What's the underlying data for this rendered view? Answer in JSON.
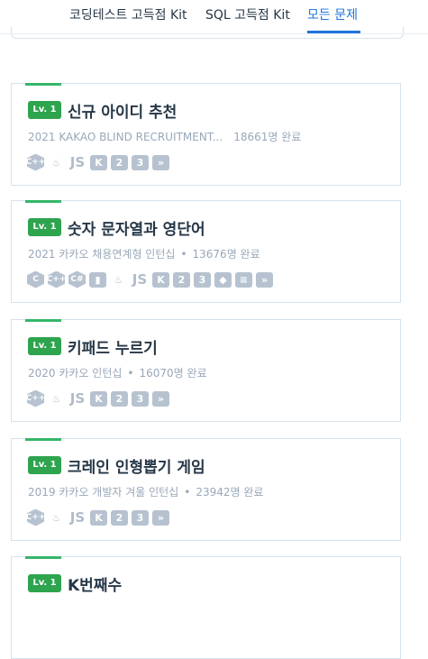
{
  "tabs": [
    {
      "label": "코딩테스트 고득점 Kit",
      "active": false
    },
    {
      "label": "SQL 고득점 Kit",
      "active": false
    },
    {
      "label": "모든 문제",
      "active": true
    }
  ],
  "colors": {
    "accent": "#1f74d9",
    "level_badge": "#2ea44f",
    "card_border": "#d7e2eb",
    "meta_text": "#98a8b9",
    "icon": "#b6c2cf"
  },
  "cards": [
    {
      "level": "Lv. 1",
      "title": "신규 아이디 추천",
      "source": "2021 KAKAO BLIND RECRUITMENT...",
      "separator": "",
      "completed": "18661명 완료",
      "languages": [
        {
          "icon": "cpp-icon",
          "glyph": "C++"
        },
        {
          "icon": "java-icon",
          "glyph": "♨"
        },
        {
          "icon": "javascript-icon",
          "glyph": "JS"
        },
        {
          "icon": "kotlin-icon",
          "glyph": "K"
        },
        {
          "icon": "python2-icon",
          "glyph": "2"
        },
        {
          "icon": "python3-icon",
          "glyph": "3"
        },
        {
          "icon": "swift-icon",
          "glyph": "»"
        }
      ]
    },
    {
      "level": "Lv. 1",
      "title": "숫자 문자열과 영단어",
      "source": "2021 카카오 채용연계형 인턴십",
      "separator": "•",
      "completed": "13676명 완료",
      "languages": [
        {
          "icon": "c-icon",
          "glyph": "C"
        },
        {
          "icon": "cpp-icon",
          "glyph": "C++"
        },
        {
          "icon": "csharp-icon",
          "glyph": "C#"
        },
        {
          "icon": "go-icon",
          "glyph": "▮"
        },
        {
          "icon": "java-icon",
          "glyph": "♨"
        },
        {
          "icon": "javascript-icon",
          "glyph": "JS"
        },
        {
          "icon": "kotlin-icon",
          "glyph": "K"
        },
        {
          "icon": "python2-icon",
          "glyph": "2"
        },
        {
          "icon": "python3-icon",
          "glyph": "3"
        },
        {
          "icon": "ruby-icon",
          "glyph": "◆"
        },
        {
          "icon": "scala-icon",
          "glyph": "≡"
        },
        {
          "icon": "swift-icon",
          "glyph": "»"
        }
      ]
    },
    {
      "level": "Lv. 1",
      "title": "키패드 누르기",
      "source": "2020 카카오 인턴십",
      "separator": "•",
      "completed": "16070명 완료",
      "languages": [
        {
          "icon": "cpp-icon",
          "glyph": "C++"
        },
        {
          "icon": "java-icon",
          "glyph": "♨"
        },
        {
          "icon": "javascript-icon",
          "glyph": "JS"
        },
        {
          "icon": "kotlin-icon",
          "glyph": "K"
        },
        {
          "icon": "python2-icon",
          "glyph": "2"
        },
        {
          "icon": "python3-icon",
          "glyph": "3"
        },
        {
          "icon": "swift-icon",
          "glyph": "»"
        }
      ]
    },
    {
      "level": "Lv. 1",
      "title": "크레인 인형뽑기 게임",
      "source": "2019 카카오 개발자 겨울 인턴십",
      "separator": "•",
      "completed": "23942명 완료",
      "languages": [
        {
          "icon": "cpp-icon",
          "glyph": "C++"
        },
        {
          "icon": "java-icon",
          "glyph": "♨"
        },
        {
          "icon": "javascript-icon",
          "glyph": "JS"
        },
        {
          "icon": "kotlin-icon",
          "glyph": "K"
        },
        {
          "icon": "python2-icon",
          "glyph": "2"
        },
        {
          "icon": "python3-icon",
          "glyph": "3"
        },
        {
          "icon": "swift-icon",
          "glyph": "»"
        }
      ]
    },
    {
      "level": "Lv. 1",
      "title": "K번째수",
      "source": "",
      "separator": "",
      "completed": "",
      "languages": []
    }
  ]
}
